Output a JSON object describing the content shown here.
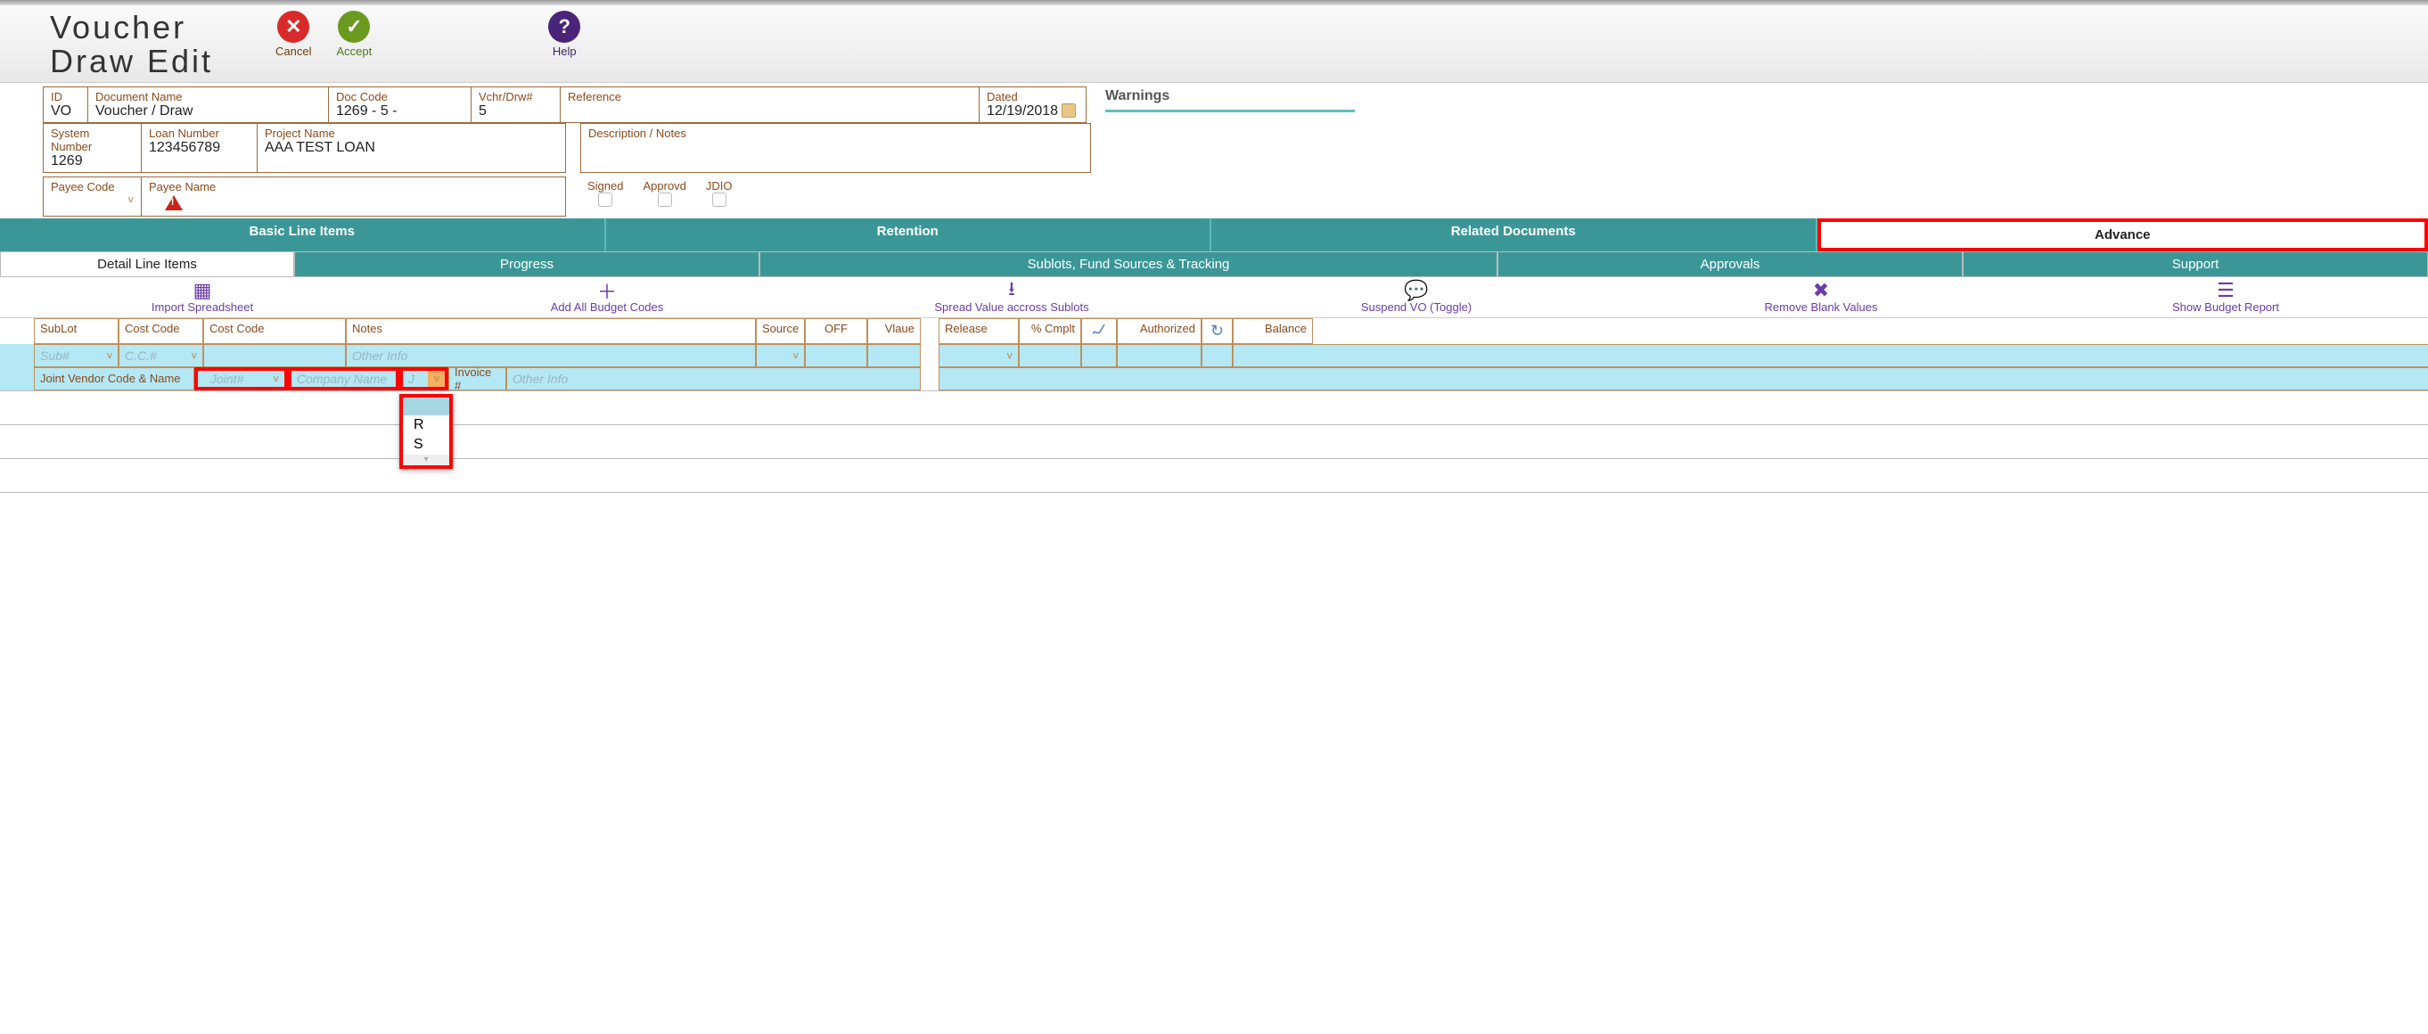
{
  "header": {
    "title": "Voucher\nDraw Edit",
    "actions": {
      "cancel": "Cancel",
      "accept": "Accept",
      "help": "Help"
    }
  },
  "form": {
    "id": {
      "label": "ID",
      "value": "VO"
    },
    "doc_name": {
      "label": "Document Name",
      "value": "Voucher / Draw"
    },
    "doc_code": {
      "label": "Doc Code",
      "value": "1269 - 5 -"
    },
    "vchrdrw": {
      "label": "Vchr/Drw#",
      "value": "5"
    },
    "reference": {
      "label": "Reference",
      "value": ""
    },
    "dated": {
      "label": "Dated",
      "value": "12/19/2018"
    },
    "sys_num": {
      "label": "System Number",
      "value": "1269"
    },
    "loan_num": {
      "label": "Loan Number",
      "value": "123456789"
    },
    "proj_name": {
      "label": "Project Name",
      "value": "AAA TEST LOAN"
    },
    "desc": {
      "label": "Description / Notes",
      "value": ""
    },
    "payee_code": {
      "label": "Payee Code",
      "value": ""
    },
    "payee_name": {
      "label": "Payee Name",
      "value": ""
    },
    "signed": "Signed",
    "approvd": "Approvd",
    "jdio": "JDIO"
  },
  "warnings_label": "Warnings",
  "teal_tabs": [
    "Basic Line Items",
    "Retention",
    "Related Documents",
    "Advance"
  ],
  "sub_tabs": [
    "Detail Line Items",
    "Progress",
    "Sublots, Fund Sources & Tracking",
    "Approvals",
    "Support"
  ],
  "actions": [
    {
      "label": "Import Spreadsheet",
      "icon": "grid"
    },
    {
      "label": "Add All Budget Codes",
      "icon": "plus"
    },
    {
      "label": "Spread Value accross Sublots",
      "icon": "download"
    },
    {
      "label": "Suspend VO (Toggle)",
      "icon": "bubble"
    },
    {
      "label": "Remove Blank Values",
      "icon": "x"
    },
    {
      "label": "Show Budget Report",
      "icon": "list"
    }
  ],
  "grid_headers": {
    "sublot_label": "SubLot",
    "sublot_ph": "Sub#",
    "cc1_label": "Cost Code",
    "cc1_ph": "C.C.#",
    "cc2_label": "Cost Code",
    "notes_label": "Notes",
    "notes_ph": "Other Info",
    "source": "Source",
    "off": "OFF",
    "value": "Vlaue",
    "release": "Release",
    "cmplt": "% Cmplt",
    "authorized": "Authorized",
    "balance": "Balance"
  },
  "jv_row": {
    "label": "Joint Vendor Code & Name",
    "joint_ph": "Joint#",
    "company_ph": "Company Name",
    "j_ph": "J",
    "invoice_label": "Invoice #",
    "invoice_ph": "Other Info"
  },
  "dropdown_options": [
    "R",
    "S"
  ]
}
